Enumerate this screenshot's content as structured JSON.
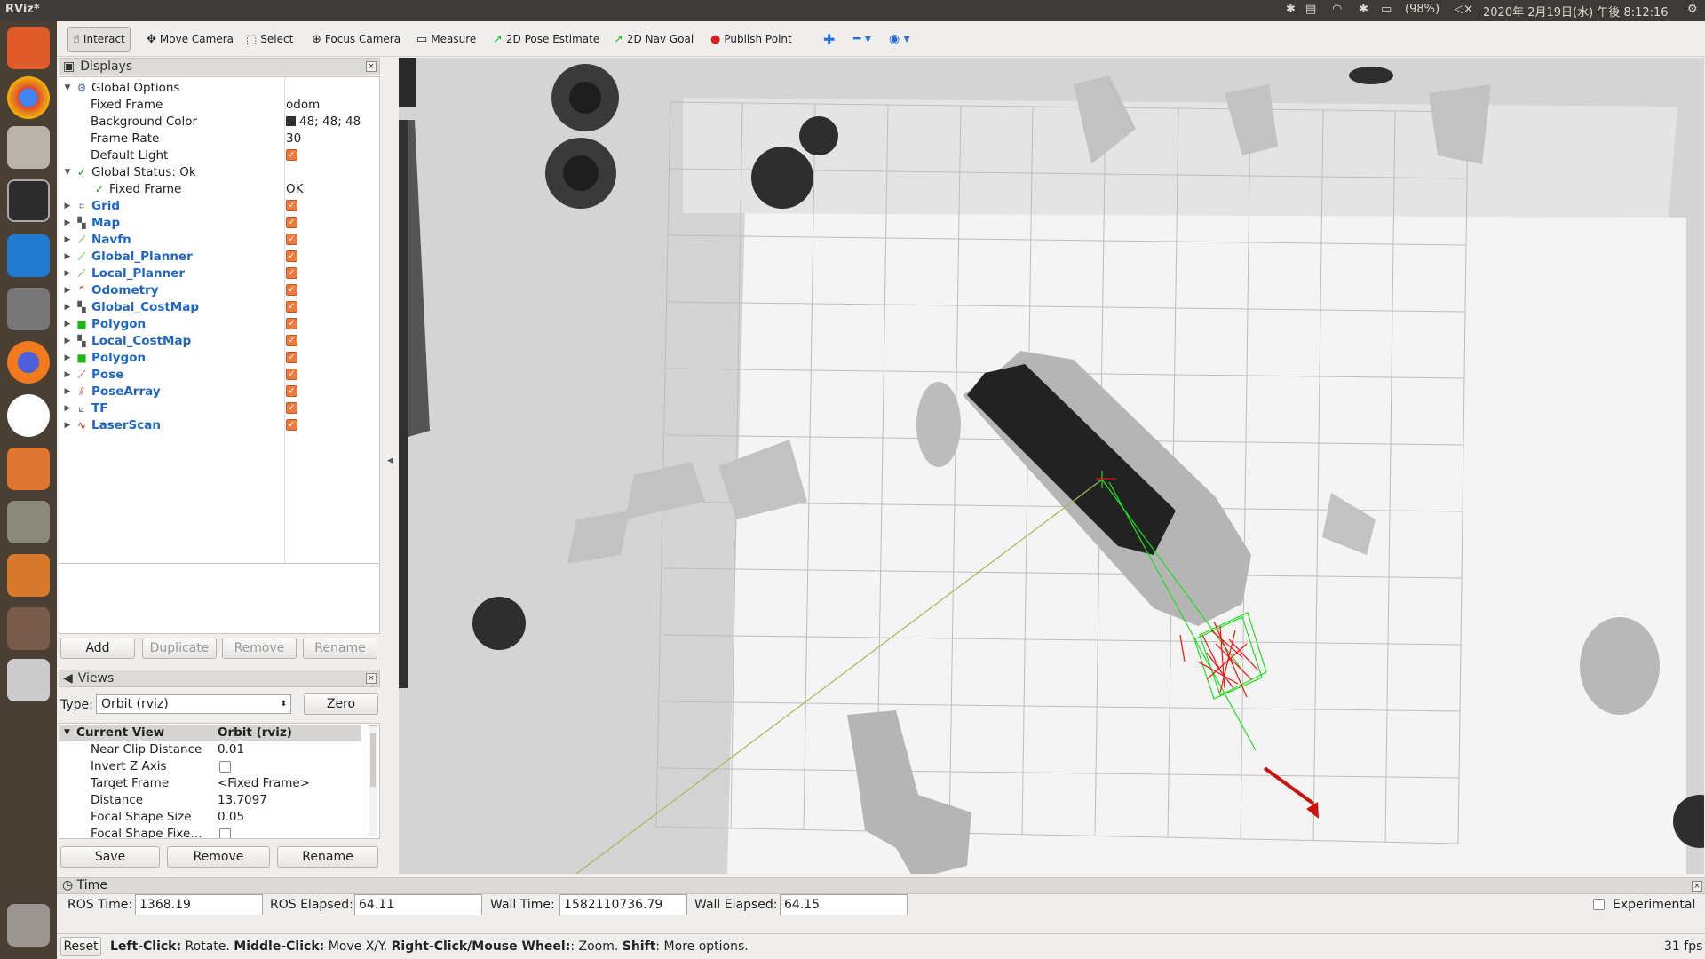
{
  "window_title": "RViz*",
  "tray": {
    "battery": "(98%)",
    "datetime": "2020年 2月19日(水) 午後 8:12:16"
  },
  "launcher_apps": [
    "ubuntu-dash",
    "chrome",
    "files",
    "terminal",
    "vscode",
    "settings",
    "firefox",
    "slack",
    "software-center",
    "system-monitor",
    "rviz",
    "workspace",
    "drive",
    "trash"
  ],
  "toolbar": {
    "interact": "Interact",
    "move_camera": "Move Camera",
    "select": "Select",
    "focus_camera": "Focus Camera",
    "measure": "Measure",
    "pose_estimate": "2D Pose Estimate",
    "nav_goal": "2D Nav Goal",
    "publish_point": "Publish Point"
  },
  "displays": {
    "title": "Displays",
    "global_options": "Global Options",
    "fixed_frame": {
      "label": "Fixed Frame",
      "value": "odom"
    },
    "background_color": {
      "label": "Background Color",
      "value": "48; 48; 48"
    },
    "frame_rate": {
      "label": "Frame Rate",
      "value": "30"
    },
    "default_light": {
      "label": "Default Light"
    },
    "global_status": "Global Status: Ok",
    "status_fixed_frame": {
      "label": "Fixed Frame",
      "value": "OK"
    },
    "items": [
      {
        "name": "Grid",
        "icon": "grid-icon"
      },
      {
        "name": "Map",
        "icon": "map-icon"
      },
      {
        "name": "Navfn",
        "icon": "path-icon"
      },
      {
        "name": "Global_Planner",
        "icon": "path-icon"
      },
      {
        "name": "Local_Planner",
        "icon": "path-icon"
      },
      {
        "name": "Odometry",
        "icon": "odometry-icon"
      },
      {
        "name": "Global_CostMap",
        "icon": "map-icon"
      },
      {
        "name": "Polygon",
        "icon": "polygon-icon"
      },
      {
        "name": "Local_CostMap",
        "icon": "map-icon"
      },
      {
        "name": "Polygon",
        "icon": "polygon-icon"
      },
      {
        "name": "Pose",
        "icon": "pose-icon"
      },
      {
        "name": "PoseArray",
        "icon": "posearray-icon"
      },
      {
        "name": "TF",
        "icon": "tf-icon"
      },
      {
        "name": "LaserScan",
        "icon": "laserscan-icon"
      }
    ],
    "buttons": {
      "add": "Add",
      "duplicate": "Duplicate",
      "remove": "Remove",
      "rename": "Rename"
    }
  },
  "views": {
    "title": "Views",
    "type_label": "Type:",
    "type_value": "Orbit (rviz)",
    "zero": "Zero",
    "header": {
      "name": "Current View",
      "value": "Orbit (rviz)"
    },
    "props": [
      {
        "label": "Near Clip Distance",
        "value": "0.01"
      },
      {
        "label": "Invert Z Axis",
        "value": ""
      },
      {
        "label": "Target Frame",
        "value": "<Fixed Frame>"
      },
      {
        "label": "Distance",
        "value": "13.7097"
      },
      {
        "label": "Focal Shape Size",
        "value": "0.05"
      },
      {
        "label": "Focal Shape Fixe…",
        "value": ""
      }
    ],
    "buttons": {
      "save": "Save",
      "remove": "Remove",
      "rename": "Rename"
    }
  },
  "time": {
    "title": "Time",
    "ros_time": {
      "label": "ROS Time:",
      "value": "1368.19"
    },
    "ros_elapsed": {
      "label": "ROS Elapsed:",
      "value": "64.11"
    },
    "wall_time": {
      "label": "Wall Time:",
      "value": "1582110736.79"
    },
    "wall_elapsed": {
      "label": "Wall Elapsed:",
      "value": "64.15"
    },
    "experimental": "Experimental"
  },
  "status": {
    "reset": "Reset",
    "hint_b1": "Left-Click:",
    "hint_t1": " Rotate. ",
    "hint_b2": "Middle-Click:",
    "hint_t2": " Move X/Y. ",
    "hint_b3": "Right-Click/Mouse Wheel:",
    "hint_t3": ": Zoom. ",
    "hint_b4": "Shift",
    "hint_t4": ": More options.",
    "fps": "31 fps"
  },
  "colors": {
    "accent_checkbox": "#ef7a3e",
    "display_name": "#1f66c5",
    "path_green": "#22dd22",
    "pose_red": "#dd1111"
  }
}
